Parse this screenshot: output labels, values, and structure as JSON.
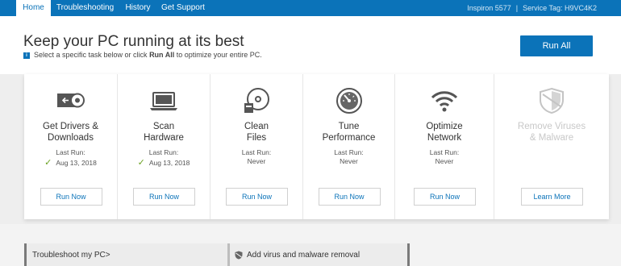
{
  "nav": {
    "tabs": [
      "Home",
      "Troubleshooting",
      "History",
      "Get Support"
    ],
    "device_model": "Inspiron 5577",
    "separator": "|",
    "service_tag": "Service Tag: H9VC4K2"
  },
  "header": {
    "title": "Keep your PC running at its best",
    "subtitle_pre": "Select a specific task below or click ",
    "subtitle_bold": "Run All",
    "subtitle_post": " to optimize your entire PC.",
    "info_icon": "info-icon",
    "run_all_label": "Run All"
  },
  "cards": [
    {
      "icon": "drivers-download-icon",
      "title": "Get Drivers &\nDownloads",
      "last_run_label": "Last Run:",
      "last_run": "Aug 13, 2018",
      "checked": true,
      "button": "Run Now",
      "disabled": false
    },
    {
      "icon": "laptop-icon",
      "title": "Scan\nHardware",
      "last_run_label": "Last Run:",
      "last_run": "Aug 13, 2018",
      "checked": true,
      "button": "Run Now",
      "disabled": false
    },
    {
      "icon": "disc-clean-icon",
      "title": "Clean\nFiles",
      "last_run_label": "Last Run:",
      "last_run": "Never",
      "checked": false,
      "button": "Run Now",
      "disabled": false
    },
    {
      "icon": "gauge-icon",
      "title": "Tune\nPerformance",
      "last_run_label": "Last Run:",
      "last_run": "Never",
      "checked": false,
      "button": "Run Now",
      "disabled": false
    },
    {
      "icon": "wifi-icon",
      "title": "Optimize\nNetwork",
      "last_run_label": "Last Run:",
      "last_run": "Never",
      "checked": false,
      "button": "Run Now",
      "disabled": false
    },
    {
      "icon": "shield-icon",
      "title": "Remove Viruses\n& Malware",
      "last_run_label": "",
      "last_run": "",
      "checked": false,
      "button": "Learn More",
      "disabled": true
    }
  ],
  "bottom": {
    "troubleshoot_label": "Troubleshoot my PC",
    "troubleshoot_chevron": ">",
    "virus_label": "Add virus and malware removal"
  },
  "colors": {
    "accent": "#0b73b9",
    "check": "#6aa121"
  }
}
